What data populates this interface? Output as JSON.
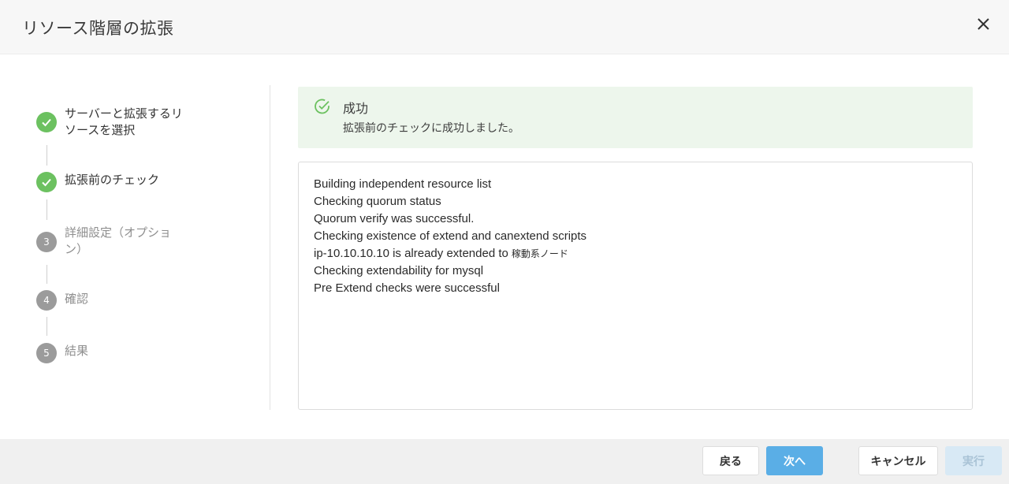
{
  "dialog": {
    "title": "リソース階層の拡張",
    "close_icon": "close-icon"
  },
  "steps": [
    {
      "number": "1",
      "label_line1": "サーバーと拡張するリ",
      "label_line2": "ソースを選択",
      "status": "done"
    },
    {
      "number": "2",
      "label_line1": "拡張前のチェック",
      "label_line2": "",
      "status": "done"
    },
    {
      "number": "3",
      "label_line1": "詳細設定（オプショ",
      "label_line2": "ン）",
      "status": "pending"
    },
    {
      "number": "4",
      "label_line1": "確認",
      "label_line2": "",
      "status": "pending"
    },
    {
      "number": "5",
      "label_line1": "結果",
      "label_line2": "",
      "status": "pending"
    }
  ],
  "success": {
    "title": "成功",
    "message": "拡張前のチェックに成功しました。",
    "icon": "check-circle-icon"
  },
  "log": {
    "lines": [
      "Building independent resource list",
      "Checking quorum status",
      "Quorum verify was successful.",
      "Checking existence of extend and canextend scripts",
      "ip-10.10.10.10 is already extended to",
      "Checking extendability for mysql",
      "Pre Extend checks were successful"
    ],
    "line5_suffix": "稼動系ノード"
  },
  "footer": {
    "back_label": "戻る",
    "next_label": "次へ",
    "cancel_label": "キャンセル",
    "execute_label": "実行"
  },
  "colors": {
    "done": "#6cc160",
    "pending": "#9b9b9b",
    "primary": "#5aaee6",
    "success_bg": "#edf6ec"
  }
}
